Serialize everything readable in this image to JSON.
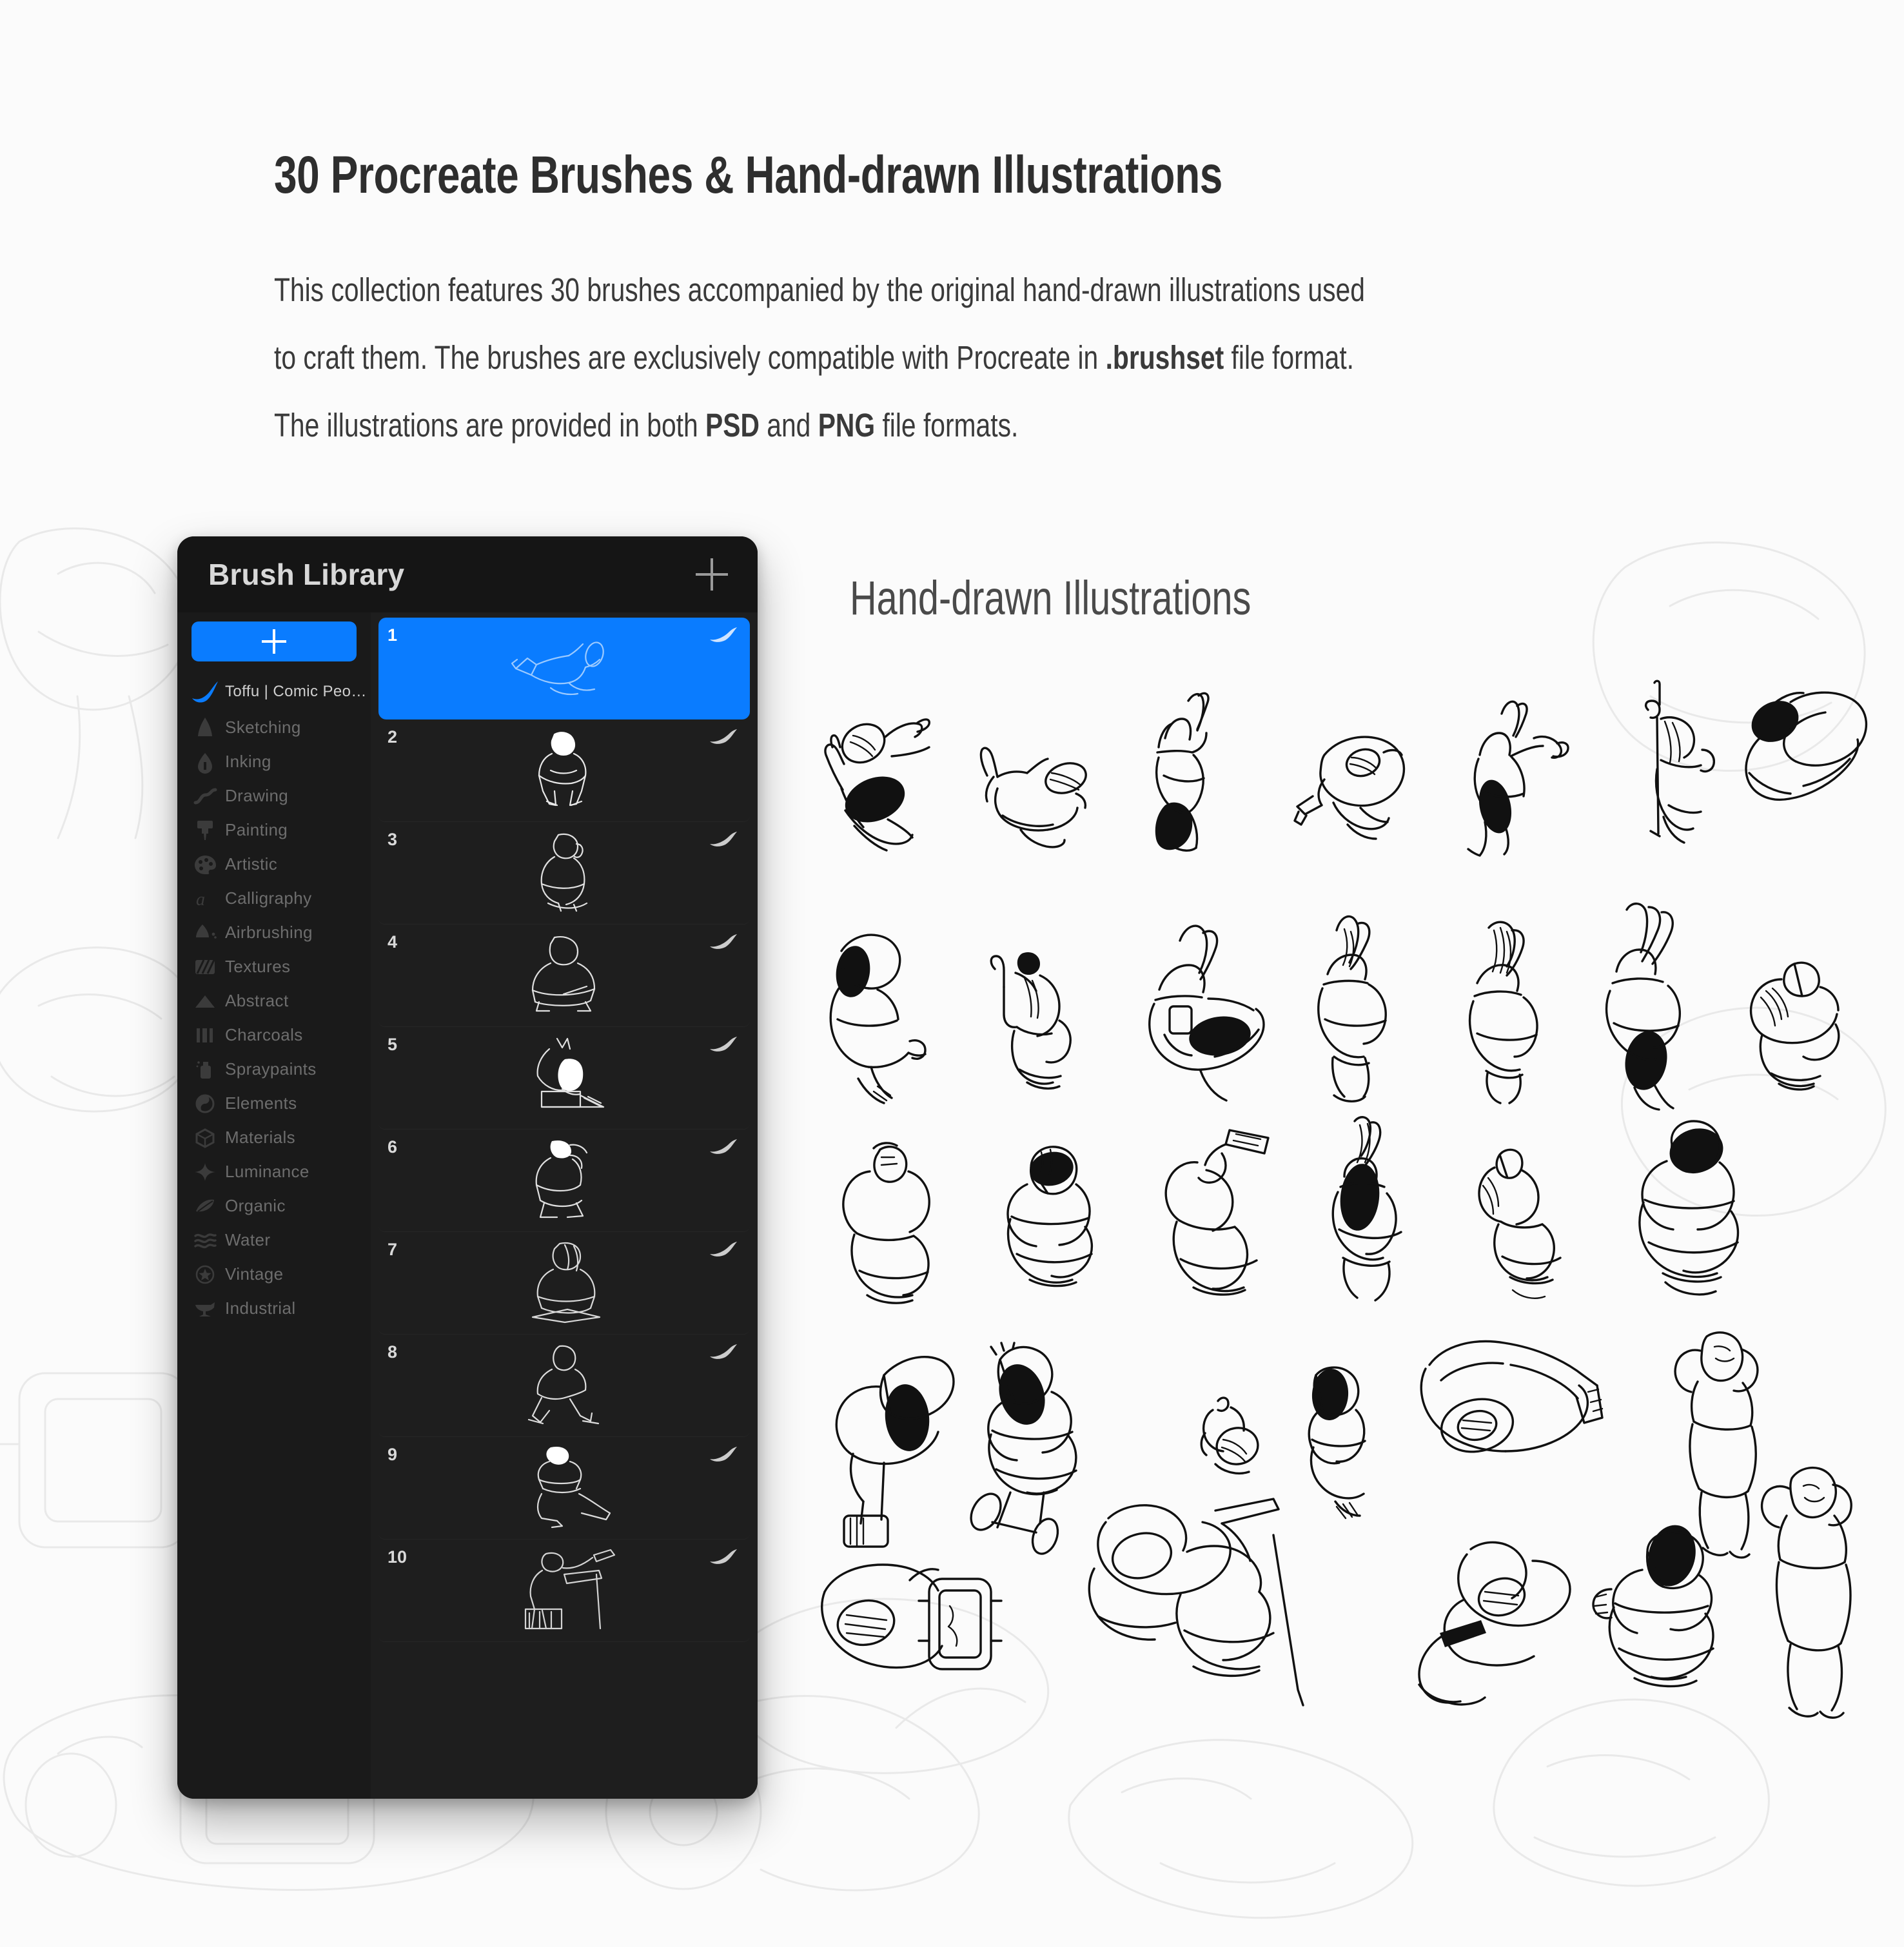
{
  "header": {
    "title": "30 Procreate Brushes & Hand-drawn Illustrations",
    "paragraph_line1_a": "This collection features 30 brushes accompanied by the original hand-drawn illustrations used",
    "paragraph_line2_a": "to craft them. The brushes are exclusively compatible with Procreate in ",
    "paragraph_line2_b": ".brushset",
    "paragraph_line2_c": " file format.",
    "paragraph_line3_a": "The illustrations are provided in both ",
    "paragraph_line3_b": "PSD",
    "paragraph_line3_c": " and ",
    "paragraph_line3_d": "PNG",
    "paragraph_line3_e": " file formats."
  },
  "illustrations_section": {
    "heading": "Hand-drawn Illustrations"
  },
  "brush_panel": {
    "title": "Brush Library",
    "add_icon": "plus-icon",
    "new_set_button": {
      "icon": "plus-icon",
      "label": ""
    },
    "sets": [
      {
        "label": "Toffu | Comic People...",
        "icon": "procreate-brush-icon",
        "active": true
      },
      {
        "label": "Sketching",
        "icon": "pencil-icon",
        "active": false
      },
      {
        "label": "Inking",
        "icon": "ink-pen-icon",
        "active": false
      },
      {
        "label": "Drawing",
        "icon": "squiggle-icon",
        "active": false
      },
      {
        "label": "Painting",
        "icon": "paintbrush-icon",
        "active": false
      },
      {
        "label": "Artistic",
        "icon": "palette-icon",
        "active": false
      },
      {
        "label": "Calligraphy",
        "icon": "script-a-icon",
        "active": false
      },
      {
        "label": "Airbrushing",
        "icon": "airbrush-icon",
        "active": false
      },
      {
        "label": "Textures",
        "icon": "hatch-icon",
        "active": false
      },
      {
        "label": "Abstract",
        "icon": "triangle-icon",
        "active": false
      },
      {
        "label": "Charcoals",
        "icon": "bars-icon",
        "active": false
      },
      {
        "label": "Spraypaints",
        "icon": "spraycan-icon",
        "active": false
      },
      {
        "label": "Elements",
        "icon": "yin-yang-icon",
        "active": false
      },
      {
        "label": "Materials",
        "icon": "cube-icon",
        "active": false
      },
      {
        "label": "Luminance",
        "icon": "sparkle-icon",
        "active": false
      },
      {
        "label": "Organic",
        "icon": "leaf-icon",
        "active": false
      },
      {
        "label": "Water",
        "icon": "waves-icon",
        "active": false
      },
      {
        "label": "Vintage",
        "icon": "star-badge-icon",
        "active": false
      },
      {
        "label": "Industrial",
        "icon": "anvil-icon",
        "active": false
      }
    ],
    "brushes": [
      {
        "number": "1",
        "thumb": "figure-reclining-reading",
        "selected": true,
        "stroke_icon": "brush-stroke-icon"
      },
      {
        "number": "2",
        "thumb": "figure-sitting-knees-up",
        "selected": false,
        "stroke_icon": "brush-stroke-icon"
      },
      {
        "number": "3",
        "thumb": "figure-sitting-headphones",
        "selected": false,
        "stroke_icon": "brush-stroke-icon"
      },
      {
        "number": "4",
        "thumb": "figure-crosslegged-tablet",
        "selected": false,
        "stroke_icon": "brush-stroke-icon"
      },
      {
        "number": "5",
        "thumb": "figure-at-laptop",
        "selected": false,
        "stroke_icon": "brush-stroke-icon"
      },
      {
        "number": "6",
        "thumb": "figure-drinking-seated",
        "selected": false,
        "stroke_icon": "brush-stroke-icon"
      },
      {
        "number": "7",
        "thumb": "figure-crosslegged-mug",
        "selected": false,
        "stroke_icon": "brush-stroke-icon"
      },
      {
        "number": "8",
        "thumb": "figure-walking-bag",
        "selected": false,
        "stroke_icon": "brush-stroke-icon"
      },
      {
        "number": "9",
        "thumb": "figure-stretching-seated",
        "selected": false,
        "stroke_icon": "brush-stroke-icon"
      },
      {
        "number": "10",
        "thumb": "figure-easel-painting",
        "selected": false,
        "stroke_icon": "brush-stroke-icon"
      }
    ]
  },
  "colors": {
    "page_background": "#fbfbfb",
    "panel_background": "#151515",
    "panel_sidebar": "#1a1a1a",
    "panel_list": "#1e1e1e",
    "accent_blue": "#0a7cff",
    "title_text": "#2e2e2e",
    "body_text": "#3a3a3a",
    "heading_grey": "#4a4a4a",
    "line_art": "#111111",
    "watermark": "#e9e9e9"
  },
  "illustration_grid": {
    "rows": 5,
    "columns_per_row": [
      7,
      7,
      6,
      6,
      5
    ],
    "total_visible": 31,
    "style": "black line-art human figures, various reclining / sitting / lounging poses, solid black hair fills"
  }
}
